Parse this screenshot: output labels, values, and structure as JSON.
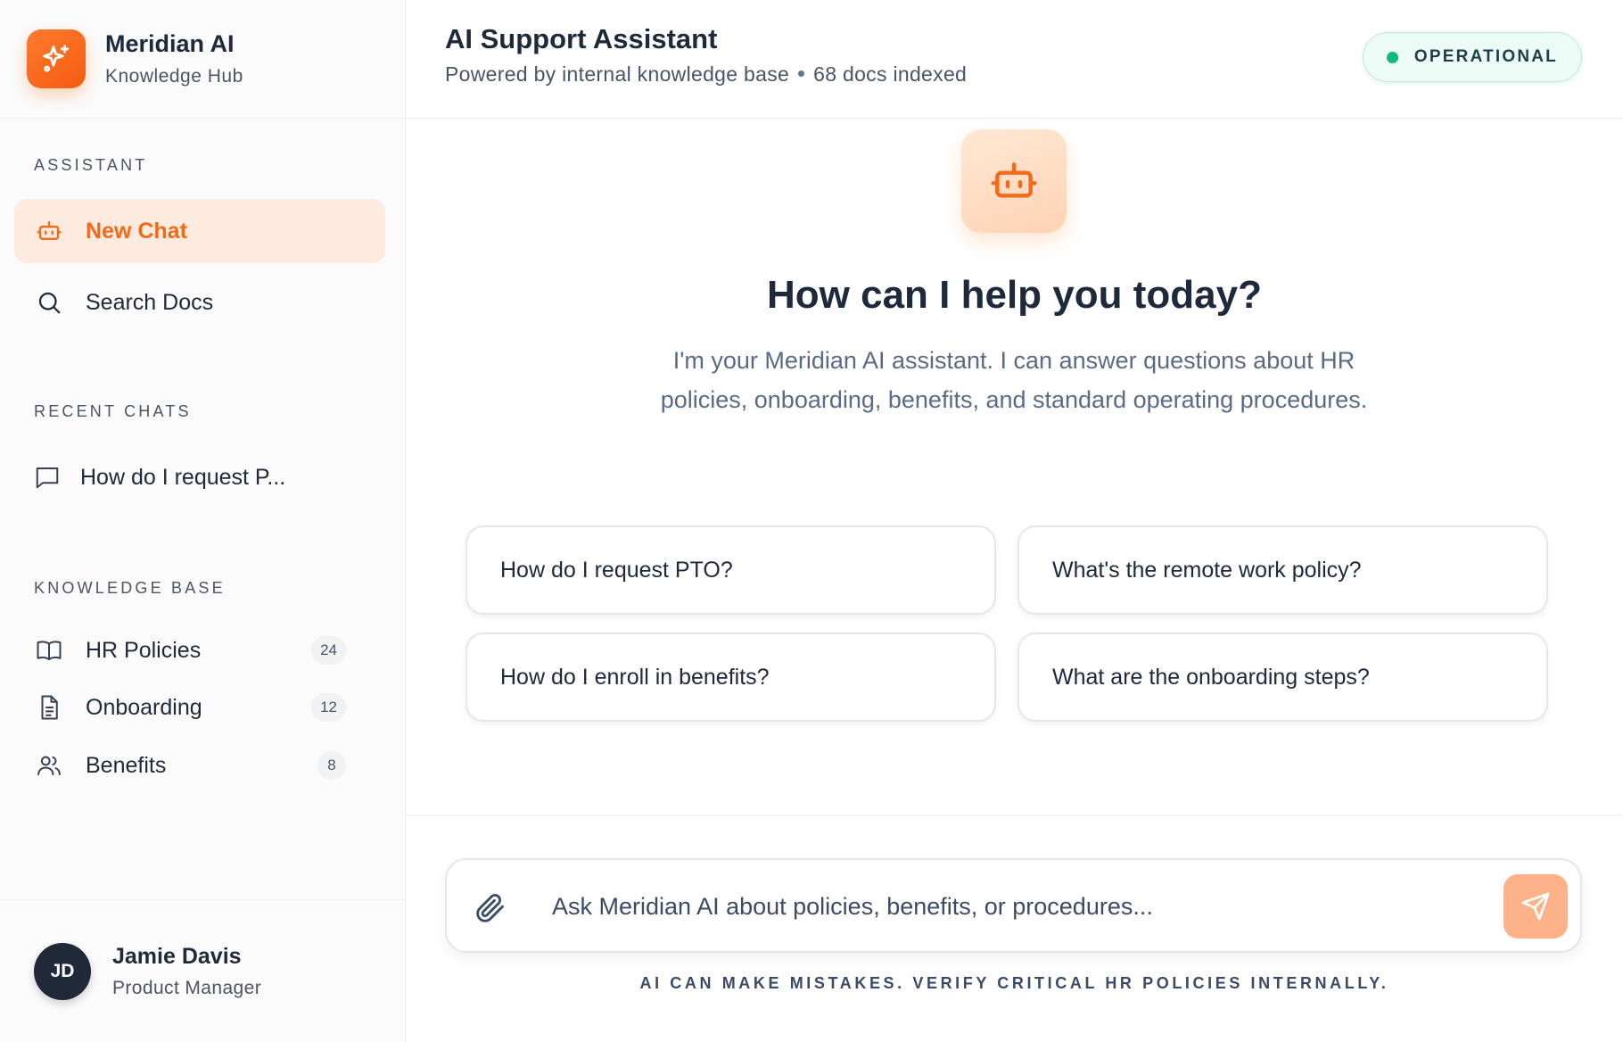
{
  "brand": {
    "name": "Meridian AI",
    "subtitle": "Knowledge Hub"
  },
  "sidebar": {
    "assistant_label": "ASSISTANT",
    "assistant_items": [
      {
        "label": "New Chat",
        "icon": "bot-icon",
        "active": true
      },
      {
        "label": "Search Docs",
        "icon": "search-icon",
        "active": false
      }
    ],
    "recent_label": "RECENT CHATS",
    "recent_items": [
      {
        "label": "How do I request P...",
        "icon": "chat-bubble-icon"
      }
    ],
    "kb_label": "KNOWLEDGE BASE",
    "kb_items": [
      {
        "label": "HR Policies",
        "count": "24",
        "icon": "book-icon"
      },
      {
        "label": "Onboarding",
        "count": "12",
        "icon": "document-icon"
      },
      {
        "label": "Benefits",
        "count": "8",
        "icon": "users-icon"
      }
    ]
  },
  "user": {
    "initials": "JD",
    "name": "Jamie Davis",
    "role": "Product Manager"
  },
  "header": {
    "title": "AI Support Assistant",
    "subtitle_left": "Powered by internal knowledge base",
    "subtitle_right": "68 docs indexed",
    "status": "OPERATIONAL"
  },
  "hero": {
    "title": "How can I help you today?",
    "description": "I'm your Meridian AI assistant. I can answer questions about HR policies, onboarding, benefits, and standard operating procedures."
  },
  "prompts": [
    "How do I request PTO?",
    "What's the remote work policy?",
    "How do I enroll in benefits?",
    "What are the onboarding steps?"
  ],
  "composer": {
    "placeholder": "Ask Meridian AI about policies, benefits, or procedures...",
    "value": ""
  },
  "disclaimer": "AI CAN MAKE MISTAKES. VERIFY CRITICAL HR POLICIES INTERNALLY.",
  "colors": {
    "accent": "#f26a1b",
    "accent_soft": "#fdebdf",
    "status_green": "#10b981",
    "text_dark": "#1e293b"
  }
}
